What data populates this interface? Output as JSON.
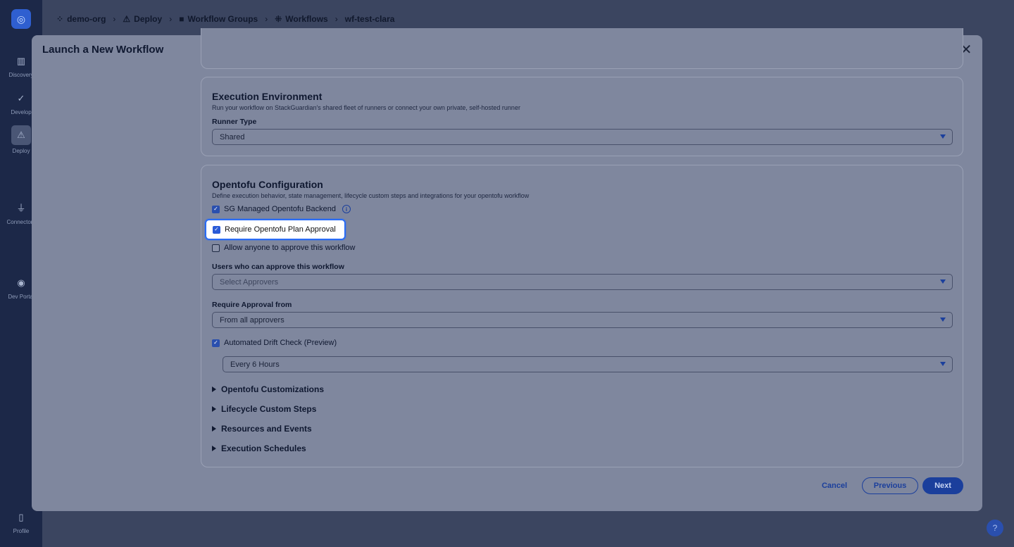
{
  "background": {
    "sidebar": [
      {
        "label": "Discovery",
        "icon": "bar-chart-icon"
      },
      {
        "label": "Develop",
        "icon": "code-icon"
      },
      {
        "label": "Deploy",
        "icon": "deploy-icon"
      },
      {
        "label": "Connectors",
        "icon": "plug-icon"
      },
      {
        "label": "Dev Portal",
        "icon": "globe-icon"
      },
      {
        "label": "Profile",
        "icon": "profile-icon"
      }
    ],
    "breadcrumb": [
      "demo-org",
      "Deploy",
      "Workflow Groups",
      "Workflows",
      "wf-test-clara"
    ]
  },
  "modal": {
    "title": "Launch a New Workflow",
    "execution_environment": {
      "title": "Execution Environment",
      "description": "Run your workflow on StackGuardian's shared fleet of runners or connect your own private, self-hosted runner",
      "runner_type_label": "Runner Type",
      "runner_type_value": "Shared"
    },
    "opentofu": {
      "title": "Opentofu Configuration",
      "description": "Define execution behavior, state management, lifecycle custom steps and integrations for your opentofu workflow",
      "sg_managed_backend": {
        "label": "SG Managed Opentofu Backend",
        "checked": true
      },
      "require_plan_approval": {
        "label": "Require Opentofu Plan Approval",
        "checked": true
      },
      "allow_anyone": {
        "label": "Allow anyone to approve this workflow",
        "checked": false
      },
      "approvers_label": "Users who can approve this workflow",
      "approvers_placeholder": "Select Approvers",
      "approval_from_label": "Require Approval from",
      "approval_from_value": "From all approvers",
      "drift_check": {
        "label": "Automated Drift Check (Preview)",
        "checked": true
      },
      "drift_interval": "Every 6 Hours",
      "sections": [
        "Opentofu Customizations",
        "Lifecycle Custom Steps",
        "Resources and Events",
        "Execution Schedules"
      ]
    },
    "footer": {
      "cancel": "Cancel",
      "previous": "Previous",
      "next": "Next"
    }
  }
}
